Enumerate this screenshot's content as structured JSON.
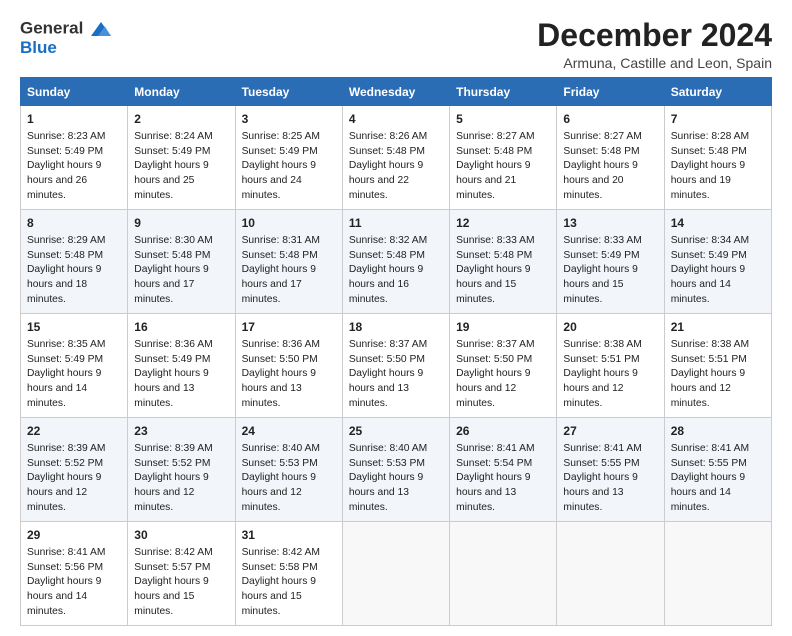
{
  "logo": {
    "line1": "General",
    "line2": "Blue"
  },
  "title": "December 2024",
  "subtitle": "Armuna, Castille and Leon, Spain",
  "headers": [
    "Sunday",
    "Monday",
    "Tuesday",
    "Wednesday",
    "Thursday",
    "Friday",
    "Saturday"
  ],
  "weeks": [
    [
      {
        "day": "1",
        "sunrise": "8:23 AM",
        "sunset": "5:49 PM",
        "daylight": "9 hours and 26 minutes."
      },
      {
        "day": "2",
        "sunrise": "8:24 AM",
        "sunset": "5:49 PM",
        "daylight": "9 hours and 25 minutes."
      },
      {
        "day": "3",
        "sunrise": "8:25 AM",
        "sunset": "5:49 PM",
        "daylight": "9 hours and 24 minutes."
      },
      {
        "day": "4",
        "sunrise": "8:26 AM",
        "sunset": "5:48 PM",
        "daylight": "9 hours and 22 minutes."
      },
      {
        "day": "5",
        "sunrise": "8:27 AM",
        "sunset": "5:48 PM",
        "daylight": "9 hours and 21 minutes."
      },
      {
        "day": "6",
        "sunrise": "8:27 AM",
        "sunset": "5:48 PM",
        "daylight": "9 hours and 20 minutes."
      },
      {
        "day": "7",
        "sunrise": "8:28 AM",
        "sunset": "5:48 PM",
        "daylight": "9 hours and 19 minutes."
      }
    ],
    [
      {
        "day": "8",
        "sunrise": "8:29 AM",
        "sunset": "5:48 PM",
        "daylight": "9 hours and 18 minutes."
      },
      {
        "day": "9",
        "sunrise": "8:30 AM",
        "sunset": "5:48 PM",
        "daylight": "9 hours and 17 minutes."
      },
      {
        "day": "10",
        "sunrise": "8:31 AM",
        "sunset": "5:48 PM",
        "daylight": "9 hours and 17 minutes."
      },
      {
        "day": "11",
        "sunrise": "8:32 AM",
        "sunset": "5:48 PM",
        "daylight": "9 hours and 16 minutes."
      },
      {
        "day": "12",
        "sunrise": "8:33 AM",
        "sunset": "5:48 PM",
        "daylight": "9 hours and 15 minutes."
      },
      {
        "day": "13",
        "sunrise": "8:33 AM",
        "sunset": "5:49 PM",
        "daylight": "9 hours and 15 minutes."
      },
      {
        "day": "14",
        "sunrise": "8:34 AM",
        "sunset": "5:49 PM",
        "daylight": "9 hours and 14 minutes."
      }
    ],
    [
      {
        "day": "15",
        "sunrise": "8:35 AM",
        "sunset": "5:49 PM",
        "daylight": "9 hours and 14 minutes."
      },
      {
        "day": "16",
        "sunrise": "8:36 AM",
        "sunset": "5:49 PM",
        "daylight": "9 hours and 13 minutes."
      },
      {
        "day": "17",
        "sunrise": "8:36 AM",
        "sunset": "5:50 PM",
        "daylight": "9 hours and 13 minutes."
      },
      {
        "day": "18",
        "sunrise": "8:37 AM",
        "sunset": "5:50 PM",
        "daylight": "9 hours and 13 minutes."
      },
      {
        "day": "19",
        "sunrise": "8:37 AM",
        "sunset": "5:50 PM",
        "daylight": "9 hours and 12 minutes."
      },
      {
        "day": "20",
        "sunrise": "8:38 AM",
        "sunset": "5:51 PM",
        "daylight": "9 hours and 12 minutes."
      },
      {
        "day": "21",
        "sunrise": "8:38 AM",
        "sunset": "5:51 PM",
        "daylight": "9 hours and 12 minutes."
      }
    ],
    [
      {
        "day": "22",
        "sunrise": "8:39 AM",
        "sunset": "5:52 PM",
        "daylight": "9 hours and 12 minutes."
      },
      {
        "day": "23",
        "sunrise": "8:39 AM",
        "sunset": "5:52 PM",
        "daylight": "9 hours and 12 minutes."
      },
      {
        "day": "24",
        "sunrise": "8:40 AM",
        "sunset": "5:53 PM",
        "daylight": "9 hours and 12 minutes."
      },
      {
        "day": "25",
        "sunrise": "8:40 AM",
        "sunset": "5:53 PM",
        "daylight": "9 hours and 13 minutes."
      },
      {
        "day": "26",
        "sunrise": "8:41 AM",
        "sunset": "5:54 PM",
        "daylight": "9 hours and 13 minutes."
      },
      {
        "day": "27",
        "sunrise": "8:41 AM",
        "sunset": "5:55 PM",
        "daylight": "9 hours and 13 minutes."
      },
      {
        "day": "28",
        "sunrise": "8:41 AM",
        "sunset": "5:55 PM",
        "daylight": "9 hours and 14 minutes."
      }
    ],
    [
      {
        "day": "29",
        "sunrise": "8:41 AM",
        "sunset": "5:56 PM",
        "daylight": "9 hours and 14 minutes."
      },
      {
        "day": "30",
        "sunrise": "8:42 AM",
        "sunset": "5:57 PM",
        "daylight": "9 hours and 15 minutes."
      },
      {
        "day": "31",
        "sunrise": "8:42 AM",
        "sunset": "5:58 PM",
        "daylight": "9 hours and 15 minutes."
      },
      null,
      null,
      null,
      null
    ]
  ]
}
